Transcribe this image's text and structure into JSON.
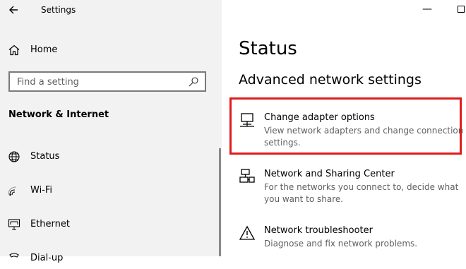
{
  "window": {
    "app_title": "Settings",
    "minimize_symbol": "—"
  },
  "sidebar": {
    "home_label": "Home",
    "search_placeholder": "Find a setting",
    "section_heading": "Network & Internet",
    "items": [
      {
        "label": "Status",
        "icon": "globe-icon"
      },
      {
        "label": "Wi-Fi",
        "icon": "wifi-icon"
      },
      {
        "label": "Ethernet",
        "icon": "ethernet-icon"
      },
      {
        "label": "Dial-up",
        "icon": "phone-icon"
      }
    ]
  },
  "main": {
    "title": "Status",
    "subtitle": "Advanced network settings",
    "options": [
      {
        "title": "Change adapter options",
        "description": "View network adapters and change connection settings.",
        "icon": "network-adapter-icon",
        "highlighted": true
      },
      {
        "title": "Network and Sharing Center",
        "description": "For the networks you connect to, decide what you want to share.",
        "icon": "sharing-center-icon",
        "highlighted": false
      },
      {
        "title": "Network troubleshooter",
        "description": "Diagnose and fix network problems.",
        "icon": "warning-icon",
        "highlighted": false
      }
    ]
  },
  "colors": {
    "sidebar_bg": "#f2f2f2",
    "highlight": "#e01b1b",
    "description_text": "#606060"
  }
}
